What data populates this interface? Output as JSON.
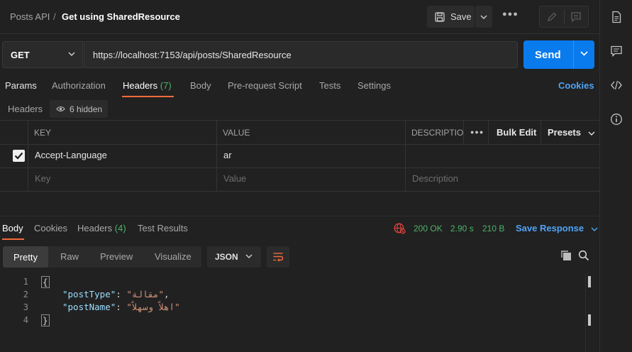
{
  "breadcrumb": {
    "parent": "Posts API",
    "separator": "/",
    "current": "Get using SharedResource"
  },
  "toolbar": {
    "save_label": "Save"
  },
  "request": {
    "method": "GET",
    "url": "https://localhost:7153/api/posts/SharedResource",
    "send_label": "Send"
  },
  "request_tabs": {
    "params": "Params",
    "authorization": "Authorization",
    "headers": "Headers",
    "headers_count": "(7)",
    "body": "Body",
    "prerequest": "Pre-request Script",
    "tests": "Tests",
    "settings": "Settings",
    "cookies": "Cookies"
  },
  "headers_section": {
    "label": "Headers",
    "hidden": "6 hidden"
  },
  "table": {
    "columns": {
      "key": "KEY",
      "value": "VALUE",
      "description": "DESCRIPTIO"
    },
    "bulk_edit": "Bulk Edit",
    "presets": "Presets",
    "rows": [
      {
        "key": "Accept-Language",
        "value": "ar",
        "description": "",
        "checked": true
      }
    ],
    "placeholder": {
      "key": "Key",
      "value": "Value",
      "description": "Description"
    }
  },
  "response_tabs": {
    "body": "Body",
    "cookies": "Cookies",
    "headers": "Headers",
    "headers_count": "(4)",
    "test_results": "Test Results"
  },
  "response_meta": {
    "status": "200 OK",
    "time": "2.90 s",
    "size": "210 B",
    "save_response": "Save Response"
  },
  "body_view": {
    "pretty": "Pretty",
    "raw": "Raw",
    "preview": "Preview",
    "visualize": "Visualize",
    "format": "JSON"
  },
  "code_lines": {
    "l1": "1",
    "l2": "2",
    "l3": "3",
    "l4": "4",
    "open": "{",
    "key1": "\"postType\"",
    "val1": "\"مقالة\"",
    "key2": "\"postName\"",
    "val2": "\"اهلاً وسهلاً\"",
    "close": "}"
  },
  "colors": {
    "accent": "#f26b3a",
    "send": "#097bed",
    "link": "#4fa3f5",
    "success": "#4db36a"
  },
  "icons": [
    "save-icon",
    "chevron-down-icon",
    "more-icon",
    "edit-icon",
    "comment-icon",
    "document-icon",
    "code-icon",
    "info-icon",
    "eye-icon",
    "checkbox-icon",
    "globe-error-icon",
    "wrap-icon",
    "copy-icon",
    "search-icon"
  ]
}
